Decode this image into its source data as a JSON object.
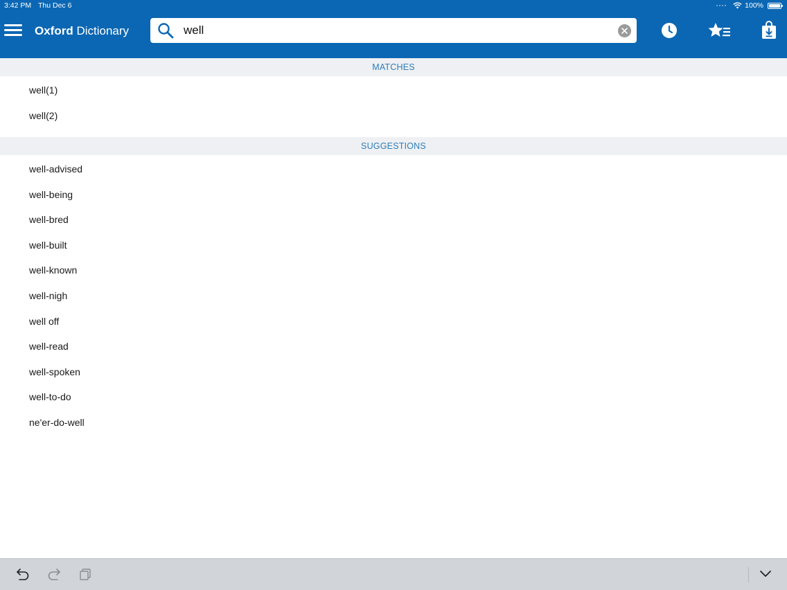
{
  "status_bar": {
    "time": "3:42 PM",
    "date": "Thu Dec 6",
    "battery": "100%"
  },
  "header": {
    "title_brand": "Oxford",
    "title_rest": " Dictionary"
  },
  "search": {
    "value": "well"
  },
  "icons": {
    "menu": "hamburger-menu-icon",
    "search": "search-icon",
    "clear": "clear-icon",
    "history": "clock-icon",
    "favorites": "star-list-icon",
    "downloads": "download-bag-icon"
  },
  "matches": {
    "heading": "MATCHES",
    "items": [
      "well(1)",
      "well(2)"
    ]
  },
  "suggestions": {
    "heading": "SUGGESTIONS",
    "items": [
      "well-advised",
      "well-being",
      "well-bred",
      "well-built",
      "well-known",
      "well-nigh",
      "well off",
      "well-read",
      "well-spoken",
      "well-to-do",
      "ne'er-do-well"
    ]
  },
  "colors": {
    "header_bg": "#0b67b3",
    "section_header_bg": "#eef0f3",
    "section_header_text": "#2f7db9",
    "bottom_bar_bg": "#d1d4d9"
  }
}
